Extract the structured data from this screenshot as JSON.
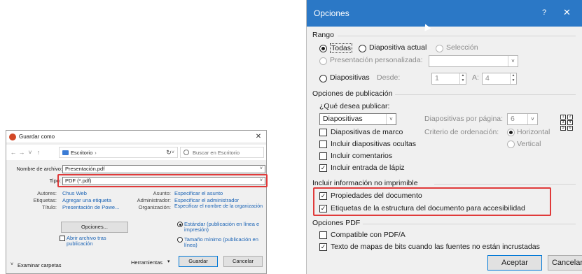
{
  "save_as": {
    "title": "Guardar como",
    "close_glyph": "✕",
    "breadcrumb": "Escritorio",
    "breadcrumb_chevron": "›",
    "search_placeholder": "Buscar en Escritorio",
    "filename_label": "Nombre de archivo:",
    "filename_value": "Presentación.pdf",
    "type_label": "Tipo:",
    "type_value": "PDF (*.pdf)",
    "authors_label": "Autores:",
    "authors_value": "Chus Web",
    "tags_label": "Etiquetas:",
    "tags_value": "Agregar una etiqueta",
    "title_label": "Título:",
    "title_value": "Presentación de Powe...",
    "subject_label": "Asunto:",
    "subject_value": "Especificar el asunto",
    "admin_label": "Administrador:",
    "admin_value": "Especificar el administrador",
    "org_label": "Organización:",
    "org_value": "Especificar el nombre de la organización",
    "options_button": "Opciones...",
    "open_after_label": "Abrir archivo tras publicación",
    "standard_label": "Estándar (publicación en línea e impresión)",
    "minimum_label": "Tamaño mínimo (publicación en línea)",
    "browse_folders": "Examinar carpetas",
    "tools_label": "Herramientas",
    "save_button": "Guardar",
    "cancel_button": "Cancelar"
  },
  "options": {
    "title": "Opciones",
    "help_glyph": "?",
    "close_glyph": "✕",
    "range_group": "Rango",
    "all_label": "Todas",
    "current_slide_label": "Diapositiva actual",
    "selection_label": "Selección",
    "custom_show_label": "Presentación personalizada:",
    "slides_label": "Diapositivas",
    "from_label": "Desde:",
    "from_value": "1",
    "to_label": "A:",
    "to_value": "4",
    "publish_group": "Opciones de publicación",
    "what_publish_label": "¿Qué desea publicar:",
    "publish_what_value": "Diapositivas",
    "slides_per_page_label": "Diapositivas por página:",
    "slides_per_page_value": "6",
    "order_label": "Criterio de ordenación:",
    "horizontal_label": "Horizontal",
    "vertical_label": "Vertical",
    "frame_slides_label": "Diapositivas de marco",
    "hidden_slides_label": "Incluir diapositivas ocultas",
    "comments_label": "Incluir comentarios",
    "ink_label": "Incluir entrada de lápiz",
    "nonprint_group": "Incluir información no imprimible",
    "doc_props_label": "Propiedades del documento",
    "struct_tags_label": "Etiquetas de la estructura del documento para accesibilidad",
    "pdf_group": "Opciones PDF",
    "pdfa_label": "Compatible con PDF/A",
    "bitmap_label": "Texto de mapas de bits cuando las fuentes no están incrustadas",
    "accept_button": "Aceptar",
    "cancel_button": "Cancelar",
    "layout_numbers": [
      "1",
      "2",
      "3",
      "4",
      "5",
      "6"
    ]
  },
  "colors": {
    "highlight": "#e03a3a",
    "titlebar": "#2b78c6",
    "link": "#1a63b5"
  }
}
